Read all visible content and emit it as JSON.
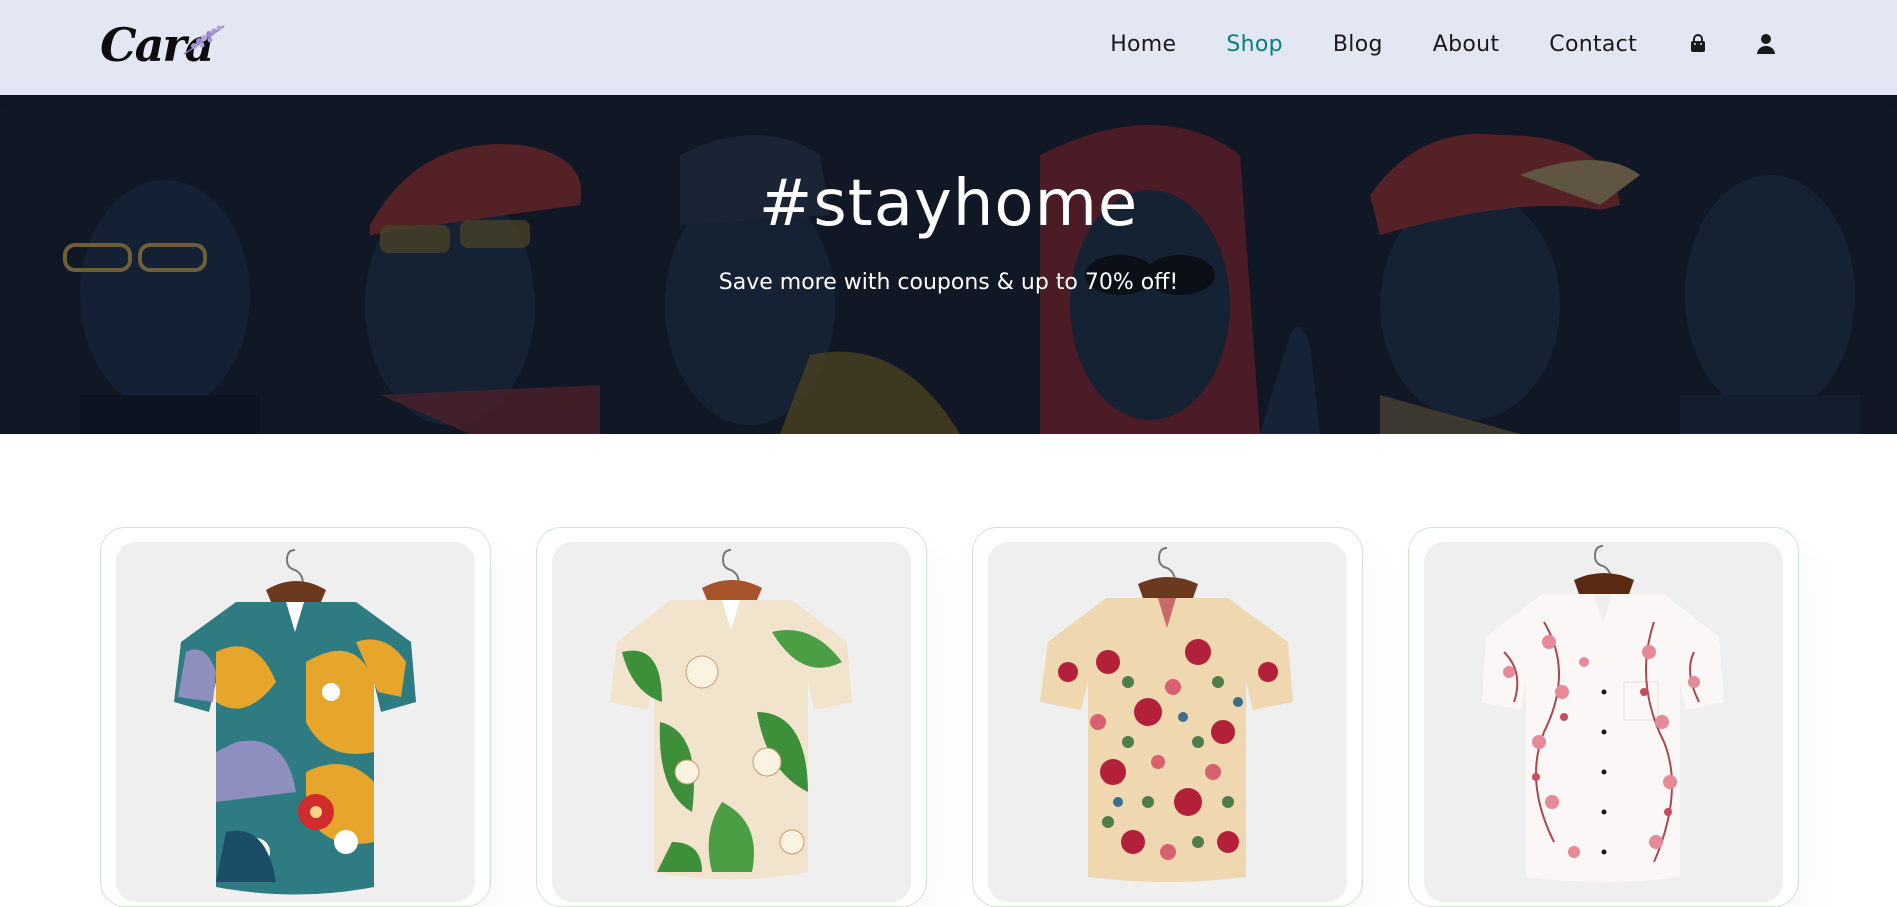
{
  "header": {
    "logo_text": "Cara",
    "nav": [
      {
        "label": "Home",
        "active": false
      },
      {
        "label": "Shop",
        "active": true
      },
      {
        "label": "Blog",
        "active": false
      },
      {
        "label": "About",
        "active": false
      },
      {
        "label": "Contact",
        "active": false
      }
    ],
    "icons": [
      "shopping-bag-icon",
      "user-icon"
    ]
  },
  "hero": {
    "title": "#stayhome",
    "subtitle": "Save more with coupons & up to 70% off!"
  },
  "products": [
    {
      "pattern": "abstract-floral-multicolor-shirt"
    },
    {
      "pattern": "green-leaf-cream-shirt"
    },
    {
      "pattern": "red-floral-beige-shirt"
    },
    {
      "pattern": "pink-blossom-white-shirt"
    }
  ],
  "colors": {
    "header_bg": "#e3e6f3",
    "accent": "#088178",
    "hero_bg": "#15202f",
    "card_border": "#cce7d0"
  }
}
